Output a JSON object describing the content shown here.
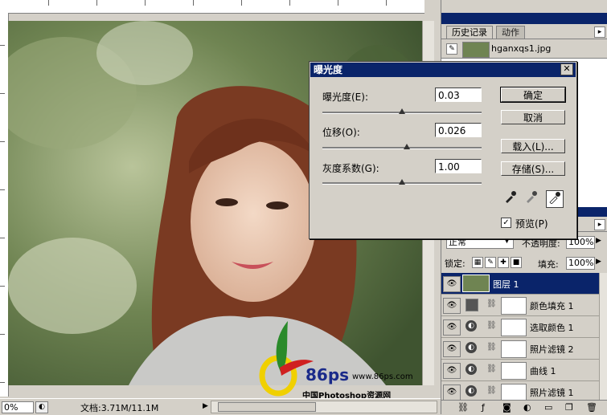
{
  "status": {
    "zoom": "0%",
    "doc_size": "文档:3.71M/11.1M"
  },
  "history_panel": {
    "tabs": [
      "历史记录",
      "动作"
    ],
    "snapshot_name": "hganxqs1.jpg"
  },
  "exposure_dialog": {
    "title": "曝光度",
    "fields": [
      {
        "label": "曝光度(E):",
        "value": "0.03",
        "slider": 0.5
      },
      {
        "label": "位移(O):",
        "value": "0.026",
        "slider": 0.53
      },
      {
        "label": "灰度系数(G):",
        "value": "1.00",
        "slider": 0.5
      }
    ],
    "buttons": {
      "ok": "确定",
      "cancel": "取消",
      "load": "载入(L)...",
      "save": "存储(S)..."
    },
    "preview_label": "预览(P)",
    "preview_checked": true
  },
  "layers_panel": {
    "blend_mode": "正常",
    "opacity_label": "不透明度:",
    "opacity": "100%",
    "lock_label": "锁定:",
    "fill_label": "填充:",
    "fill": "100%",
    "layers": [
      {
        "name": "图层 1",
        "kind": "image",
        "selected": true
      },
      {
        "name": "颜色填充 1",
        "kind": "fill",
        "selected": false
      },
      {
        "name": "选取颜色 1",
        "kind": "adjust",
        "selected": false
      },
      {
        "name": "照片滤镜 2",
        "kind": "adjust",
        "selected": false
      },
      {
        "name": "曲线 1",
        "kind": "adjust",
        "selected": false
      },
      {
        "name": "照片滤镜 1",
        "kind": "adjust",
        "selected": false
      }
    ]
  },
  "watermark": {
    "logo_text": "86ps",
    "url": "www.86ps.com",
    "site": "中国Photoshop资源网"
  },
  "colors": {
    "titlebar": "#0a246a",
    "face": "#d4d0c8"
  }
}
